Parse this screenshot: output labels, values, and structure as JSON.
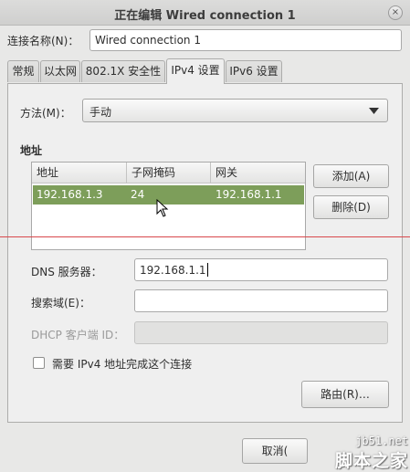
{
  "window": {
    "title": "正在编辑 Wired connection 1",
    "close_glyph": "×"
  },
  "conn_name": {
    "label": "连接名称(N)：",
    "value": "Wired connection 1"
  },
  "tabs": [
    {
      "label": "常规"
    },
    {
      "label": "以太网"
    },
    {
      "label": "802.1X 安全性"
    },
    {
      "label": "IPv4 设置",
      "active": true
    },
    {
      "label": "IPv6 设置"
    }
  ],
  "method": {
    "label": "方法(M)：",
    "value": "手动"
  },
  "address": {
    "section_label": "地址",
    "columns": [
      "地址",
      "子网掩码",
      "网关"
    ],
    "rows": [
      [
        "192.168.1.3",
        "24",
        "192.168.1.1"
      ]
    ],
    "add_label": "添加(A)",
    "delete_label": "删除(D)"
  },
  "dns": {
    "label": "DNS 服务器：",
    "value": "192.168.1.1"
  },
  "search_domain": {
    "label": "搜索域(E)：",
    "value": ""
  },
  "dhcp_id": {
    "label": "DHCP 客户端 ID：",
    "value": ""
  },
  "require_ipv4": {
    "label": "需要 IPv4 地址完成这个连接",
    "checked": false
  },
  "routes_label": "路由(R)…",
  "footer": {
    "cancel_label": "取消("
  },
  "watermark": {
    "url": "jb51.net",
    "brand": "脚本之家"
  },
  "colors": {
    "selection": "#7d9e5a",
    "marker_line": "#d8484c"
  },
  "icons": {
    "pointer": "mouse-pointer-icon",
    "dropdown": "triangle-down-icon",
    "close": "close-icon"
  }
}
